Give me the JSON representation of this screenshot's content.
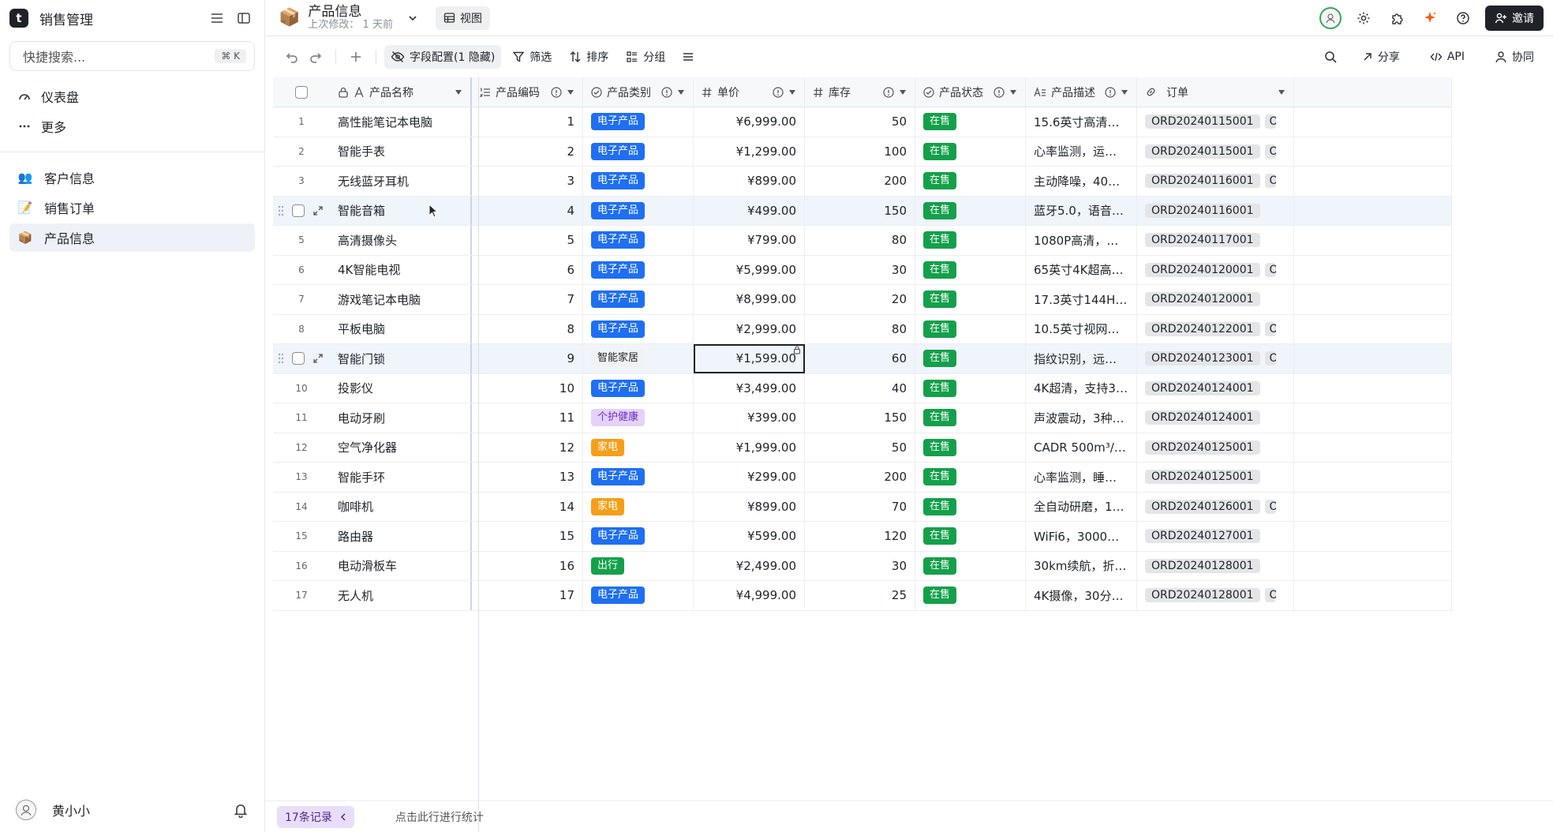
{
  "app": {
    "name": "销售管理",
    "logo_letter": "t"
  },
  "sidebar": {
    "search_placeholder": "快捷搜索...",
    "search_shortcut": "⌘ K",
    "links": [
      {
        "label": "仪表盘",
        "icon": "dashboard-icon"
      },
      {
        "label": "更多",
        "icon": "more-dots-icon"
      }
    ],
    "tables": [
      {
        "label": "客户信息",
        "emoji": "👥",
        "active": false
      },
      {
        "label": "销售订单",
        "emoji": "📝",
        "active": false
      },
      {
        "label": "产品信息",
        "emoji": "📦",
        "active": true
      }
    ],
    "user": {
      "name": "黄小小"
    }
  },
  "topbar": {
    "emoji": "📦",
    "title": "产品信息",
    "subtitle": "上次修改：  1 天前",
    "view_label": "视图",
    "invite_label": "邀请"
  },
  "toolbar": {
    "fields_label": "字段配置(1 隐藏)",
    "filter_label": "筛选",
    "sort_label": "排序",
    "group_label": "分组",
    "share_label": "分享",
    "api_label": "API",
    "collab_label": "协同"
  },
  "table": {
    "columns": [
      {
        "label": "产品名称",
        "icon": "text-field-icon"
      },
      {
        "label": "产品编码",
        "icon": "autonumber-field-icon"
      },
      {
        "label": "产品类别",
        "icon": "single-select-icon"
      },
      {
        "label": "单价",
        "icon": "number-field-icon"
      },
      {
        "label": "库存",
        "icon": "number-field-icon"
      },
      {
        "label": "产品状态",
        "icon": "single-select-icon"
      },
      {
        "label": "产品描述",
        "icon": "long-text-icon"
      },
      {
        "label": "订单",
        "icon": "link-field-icon"
      }
    ],
    "rows": [
      {
        "idx": "1",
        "name": "高性能笔记本电脑",
        "code": "1",
        "category": "电子产品",
        "cat_color": "blue",
        "price": "¥6,999.00",
        "stock": "50",
        "status": "在售",
        "desc": "15.6英寸高清屏幕，...",
        "order": "ORD20240115001",
        "more": true
      },
      {
        "idx": "2",
        "name": "智能手表",
        "code": "2",
        "category": "电子产品",
        "cat_color": "blue",
        "price": "¥1,299.00",
        "stock": "100",
        "status": "在售",
        "desc": "心率监测，运动记录...",
        "order": "ORD20240115001",
        "more": true
      },
      {
        "idx": "3",
        "name": "无线蓝牙耳机",
        "code": "3",
        "category": "电子产品",
        "cat_color": "blue",
        "price": "¥899.00",
        "stock": "200",
        "status": "在售",
        "desc": "主动降噪，40小时续...",
        "order": "ORD20240116001",
        "more": true
      },
      {
        "idx": "4",
        "name": "智能音箱",
        "code": "4",
        "category": "电子产品",
        "cat_color": "blue",
        "price": "¥499.00",
        "stock": "150",
        "status": "在售",
        "desc": "蓝牙5.0，语音控制...",
        "order": "ORD20240116001",
        "more": false,
        "hover": true
      },
      {
        "idx": "5",
        "name": "高清摄像头",
        "code": "5",
        "category": "电子产品",
        "cat_color": "blue",
        "price": "¥799.00",
        "stock": "80",
        "status": "在售",
        "desc": "1080P高清，自动对...",
        "order": "ORD20240117001",
        "more": false
      },
      {
        "idx": "6",
        "name": "4K智能电视",
        "code": "6",
        "category": "电子产品",
        "cat_color": "blue",
        "price": "¥5,999.00",
        "stock": "30",
        "status": "在售",
        "desc": "65英寸4K超高清，...",
        "order": "ORD20240120001",
        "more": true
      },
      {
        "idx": "7",
        "name": "游戏笔记本电脑",
        "code": "7",
        "category": "电子产品",
        "cat_color": "blue",
        "price": "¥8,999.00",
        "stock": "20",
        "status": "在售",
        "desc": "17.3英寸144Hz刷新...",
        "order": "ORD20240120001",
        "more": false
      },
      {
        "idx": "8",
        "name": "平板电脑",
        "code": "8",
        "category": "电子产品",
        "cat_color": "blue",
        "price": "¥2,999.00",
        "stock": "80",
        "status": "在售",
        "desc": "10.5英寸视网膜屏，...",
        "order": "ORD20240122001",
        "more": true
      },
      {
        "idx": "9",
        "name": "智能门锁",
        "code": "9",
        "category": "智能家居",
        "cat_color": "plain",
        "price": "¥1,599.00",
        "stock": "60",
        "status": "在售",
        "desc": "指纹识别，远程控制...",
        "order": "ORD20240123001",
        "more": true,
        "hover": true,
        "selected_price": true
      },
      {
        "idx": "10",
        "name": "投影仪",
        "code": "10",
        "category": "电子产品",
        "cat_color": "blue",
        "price": "¥3,499.00",
        "stock": "40",
        "status": "在售",
        "desc": "4K超清，支持3D，...",
        "order": "ORD20240124001",
        "more": false
      },
      {
        "idx": "11",
        "name": "电动牙刷",
        "code": "11",
        "category": "个护健康",
        "cat_color": "purple",
        "price": "¥399.00",
        "stock": "150",
        "status": "在售",
        "desc": "声波震动，3种模式，...",
        "order": "ORD20240124001",
        "more": false
      },
      {
        "idx": "12",
        "name": "空气净化器",
        "code": "12",
        "category": "家电",
        "cat_color": "orange",
        "price": "¥1,999.00",
        "stock": "50",
        "status": "在售",
        "desc": "CADR 500m³/h，智...",
        "order": "ORD20240125001",
        "more": false
      },
      {
        "idx": "13",
        "name": "智能手环",
        "code": "13",
        "category": "电子产品",
        "cat_color": "blue",
        "price": "¥299.00",
        "stock": "200",
        "status": "在售",
        "desc": "心率监测，睡眠分析...",
        "order": "ORD20240125001",
        "more": false
      },
      {
        "idx": "14",
        "name": "咖啡机",
        "code": "14",
        "category": "家电",
        "cat_color": "orange",
        "price": "¥899.00",
        "stock": "70",
        "status": "在售",
        "desc": "全自动研磨，15Bar...",
        "order": "ORD20240126001",
        "more": true
      },
      {
        "idx": "15",
        "name": "路由器",
        "code": "15",
        "category": "电子产品",
        "cat_color": "blue",
        "price": "¥599.00",
        "stock": "120",
        "status": "在售",
        "desc": "WiFi6，3000Mbps...",
        "order": "ORD20240127001",
        "more": false
      },
      {
        "idx": "16",
        "name": "电动滑板车",
        "code": "16",
        "category": "出行",
        "cat_color": "green",
        "price": "¥2,499.00",
        "stock": "30",
        "status": "在售",
        "desc": "30km续航，折叠设...",
        "order": "ORD20240128001",
        "more": false
      },
      {
        "idx": "17",
        "name": "无人机",
        "code": "17",
        "category": "电子产品",
        "cat_color": "blue",
        "price": "¥4,999.00",
        "stock": "25",
        "status": "在售",
        "desc": "4K摄像，30分钟续...",
        "order": "ORD20240128001",
        "more": true
      }
    ]
  },
  "footer": {
    "record_count": "17条记录",
    "stat_hint": "点击此行进行统计"
  },
  "colors": {
    "primary_dark": "#1f2329",
    "tag_blue": "#1f6ff2",
    "tag_green": "#14a04b",
    "tag_orange": "#f59f19",
    "tag_purple_bg": "#e4d2fb",
    "records_pill": "#e9ddfc"
  }
}
